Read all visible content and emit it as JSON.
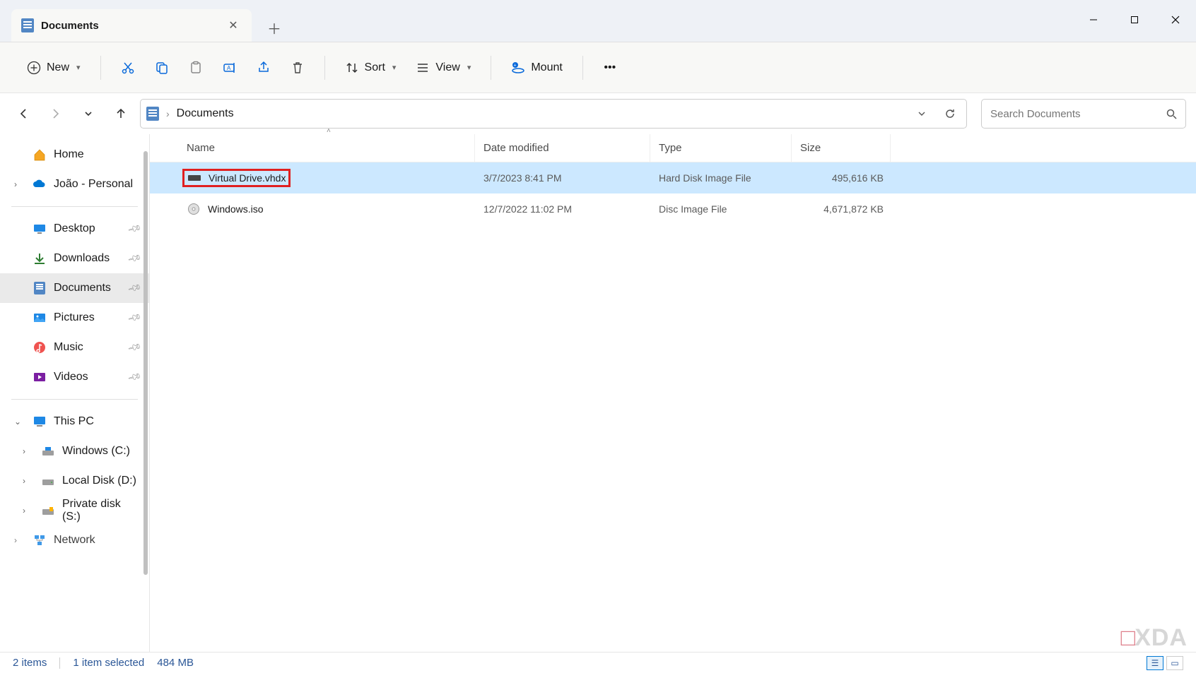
{
  "window": {
    "tab_title": "Documents"
  },
  "toolbar": {
    "new_label": "New",
    "sort_label": "Sort",
    "view_label": "View",
    "mount_label": "Mount"
  },
  "breadcrumb": {
    "current": "Documents"
  },
  "search": {
    "placeholder": "Search Documents"
  },
  "sidebar": {
    "home": "Home",
    "personal": "João - Personal",
    "desktop": "Desktop",
    "downloads": "Downloads",
    "documents": "Documents",
    "pictures": "Pictures",
    "music": "Music",
    "videos": "Videos",
    "this_pc": "This PC",
    "drive_c": "Windows (C:)",
    "drive_d": "Local Disk (D:)",
    "drive_s": "Private disk (S:)",
    "network": "Network"
  },
  "columns": {
    "name": "Name",
    "date": "Date modified",
    "type": "Type",
    "size": "Size"
  },
  "files": [
    {
      "name": "Virtual Drive.vhdx",
      "date": "3/7/2023 8:41 PM",
      "type": "Hard Disk Image File",
      "size": "495,616 KB",
      "selected": true,
      "highlighted": true
    },
    {
      "name": "Windows.iso",
      "date": "12/7/2022 11:02 PM",
      "type": "Disc Image File",
      "size": "4,671,872 KB",
      "selected": false,
      "highlighted": false
    }
  ],
  "status": {
    "count": "2 items",
    "selection": "1 item selected",
    "selection_size": "484 MB"
  },
  "watermark": "XDA"
}
